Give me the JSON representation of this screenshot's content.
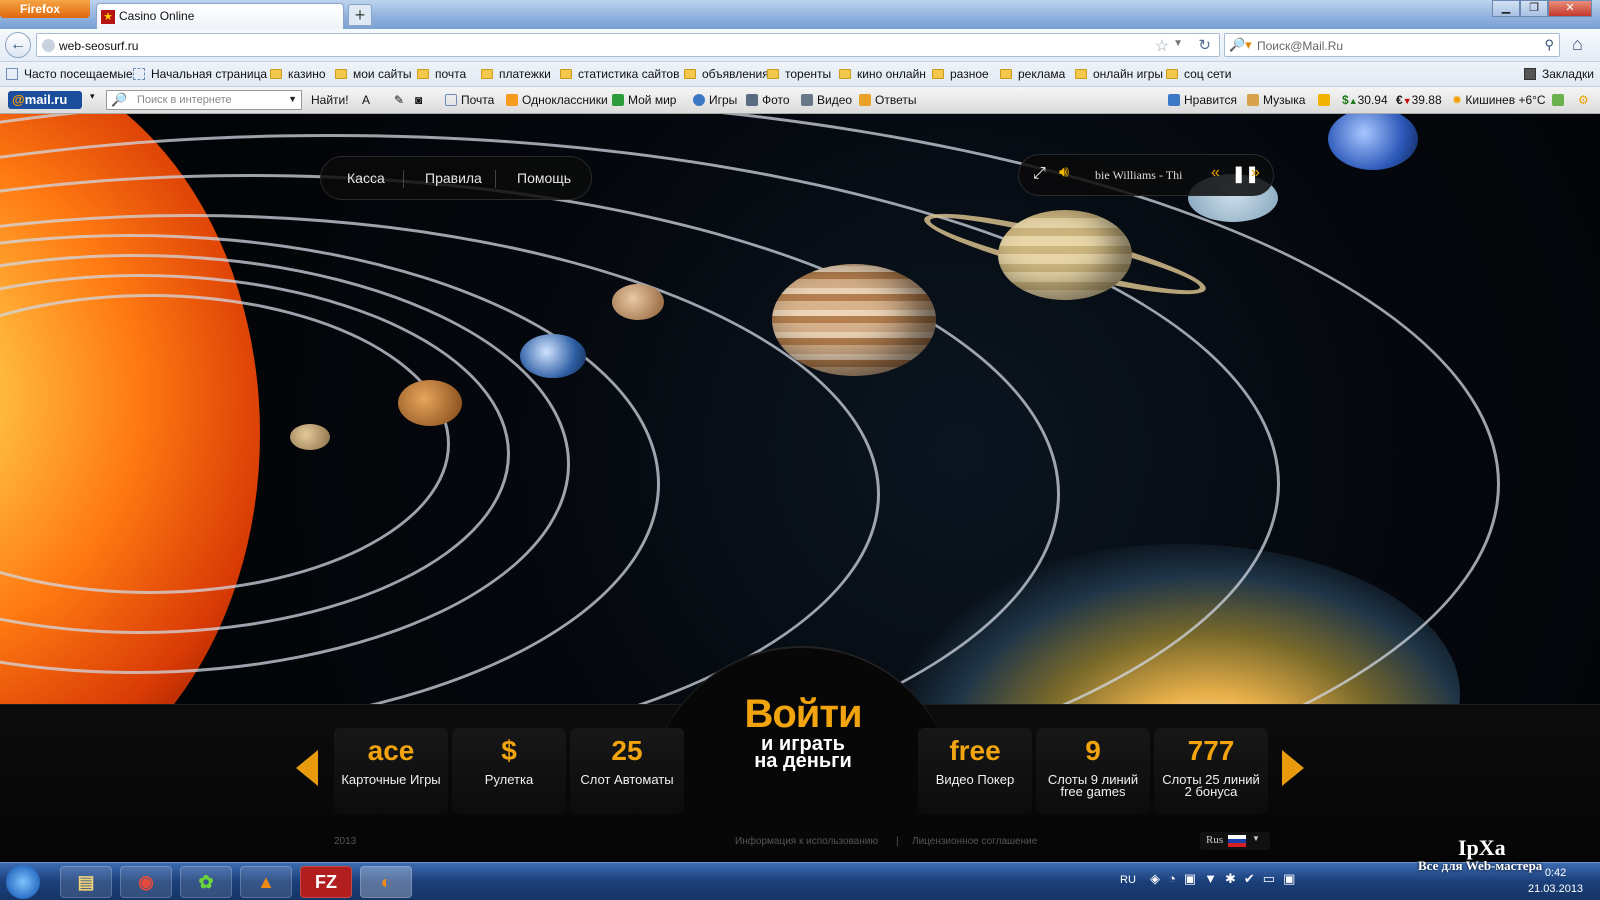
{
  "browser": {
    "app_button": "Firefox",
    "tab_title": "Casino Online",
    "new_tab": "+",
    "url": "web-seosurf.ru",
    "search_placeholder": "Поиск@Mail.Ru",
    "window_controls": [
      "minimize",
      "maximize",
      "close"
    ]
  },
  "bookmarks": {
    "items": [
      "Часто посещаемые",
      "Начальная страница",
      "казино",
      "мои сайты",
      "почта",
      "платежки",
      "статистика сайтов",
      "объявления",
      "торенты",
      "кино онлайн",
      "разное",
      "реклама",
      "онлайн игры",
      "соц сети"
    ],
    "right": "Закладки"
  },
  "mailru_toolbar": {
    "logo_at": "@",
    "logo_text": "mail.ru",
    "search_placeholder": "Поиск в интернете",
    "find_button": "Найти!",
    "links": [
      "Почта",
      "Одноклассники",
      "Мой мир",
      "Игры",
      "Фото",
      "Видео",
      "Ответы"
    ],
    "like": "Нравится",
    "music": "Музыка",
    "usd": "30.94",
    "eur": "39.88",
    "weather": "Кишинев +6°C"
  },
  "site": {
    "menu": [
      "Касса",
      "Правила",
      "Помощь"
    ],
    "player": {
      "track": "bie Williams - Thi"
    },
    "games_left": [
      {
        "icon_text": "ace",
        "label": "Карточные Игры"
      },
      {
        "icon_text": "$",
        "label": "Рулетка"
      },
      {
        "icon_text": "25",
        "label": "Слот Автоматы"
      }
    ],
    "games_right": [
      {
        "icon_text": "free",
        "label": "Видео Покер"
      },
      {
        "icon_text": "9",
        "label": "Слоты 9 линий",
        "label2": "free games"
      },
      {
        "icon_text": "777",
        "label": "Слоты 25 линий",
        "label2": "2 бонуса"
      }
    ],
    "enter_big": "Войти",
    "enter_line1": "и играть",
    "enter_line2": "на деньги",
    "footer_year": "2013",
    "footer_link1": "Информация к использованию",
    "footer_sep": "|",
    "footer_link2": "Лицензионное соглашение",
    "language": "Rus"
  },
  "taskbar": {
    "lang": "RU",
    "time": "0:42",
    "date": "21.03.2013"
  },
  "watermark": {
    "title": "IpXa",
    "tagline": "Все для Web-мастера"
  },
  "colors": {
    "accent_orange": "#f2a40e",
    "firefox_orange": "#e0670c",
    "mailru_blue": "#1a4d9c"
  }
}
